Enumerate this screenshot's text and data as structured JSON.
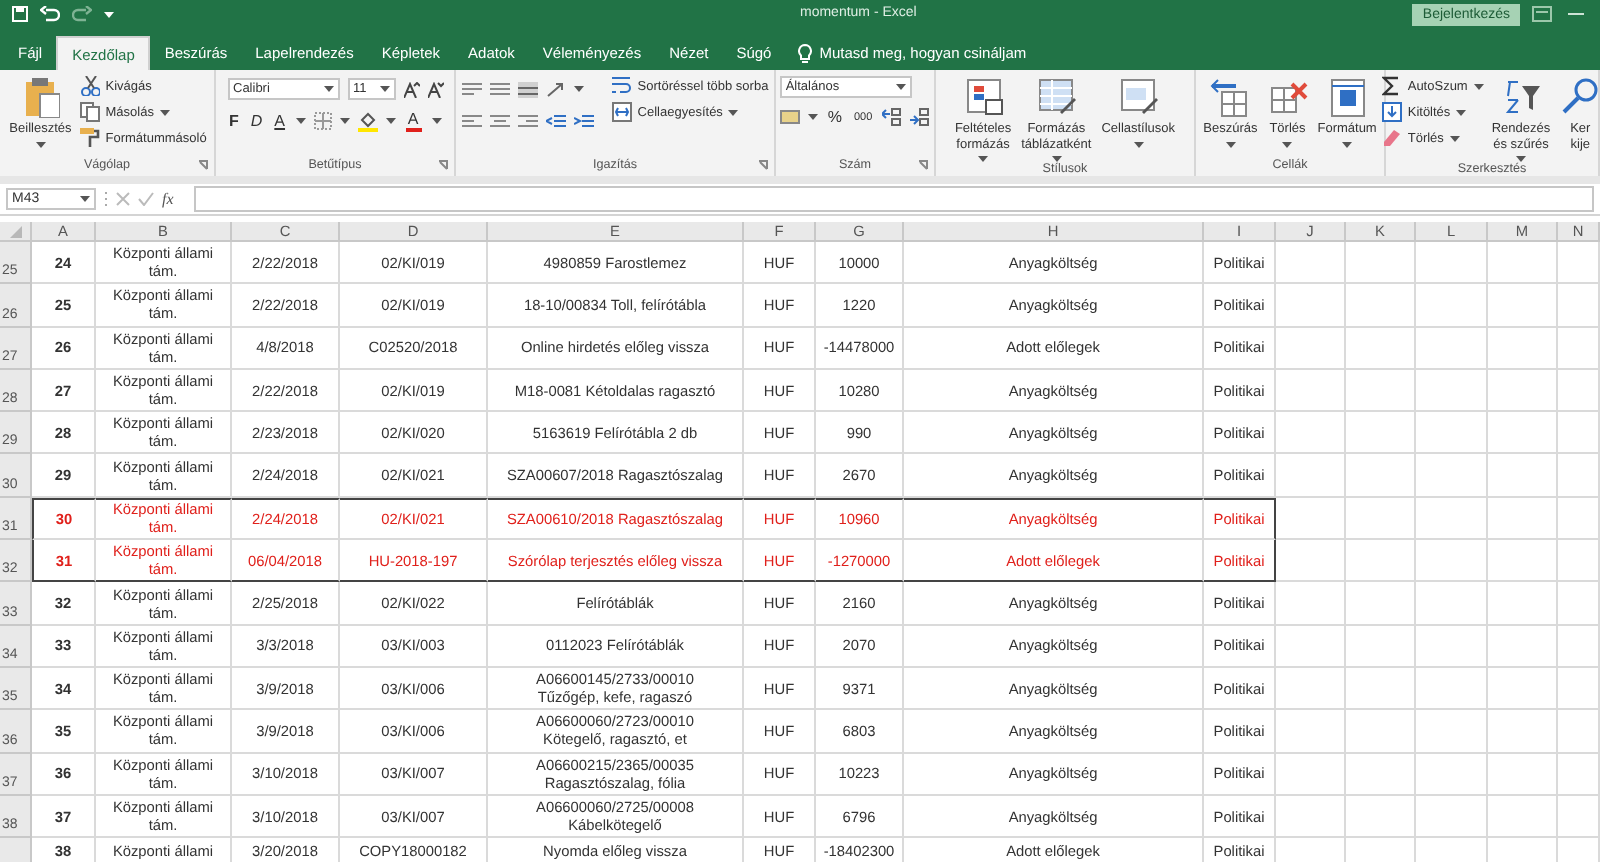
{
  "title_bar": {
    "title": "momentum - Excel",
    "sign_in": "Bejelentkezés"
  },
  "tabs": [
    {
      "label": "Fájl",
      "selected": false
    },
    {
      "label": "Kezdőlap",
      "selected": true
    },
    {
      "label": "Beszúrás",
      "selected": false
    },
    {
      "label": "Lapelrendezés",
      "selected": false
    },
    {
      "label": "Képletek",
      "selected": false
    },
    {
      "label": "Adatok",
      "selected": false
    },
    {
      "label": "Véleményezés",
      "selected": false
    },
    {
      "label": "Nézet",
      "selected": false
    },
    {
      "label": "Súgó",
      "selected": false
    }
  ],
  "tell_me": "Mutasd meg, hogyan csináljam",
  "ribbon": {
    "groups": [
      {
        "label": "Vágólap",
        "launcher": true,
        "items": [
          {
            "kind": "large",
            "label": "Beillesztés",
            "dropdown": true
          },
          {
            "kind": "stack",
            "items": [
              {
                "label": "Kivágás",
                "dropdown": false
              },
              {
                "label": "Másolás",
                "dropdown": true
              },
              {
                "label": "Formátummásoló",
                "dropdown": false
              }
            ]
          }
        ]
      },
      {
        "label": "Betűtípus",
        "launcher": true,
        "items": [
          {
            "kind": "font",
            "font": "Calibri",
            "size": "11",
            "bold": "F",
            "italic": "D",
            "underline": "A",
            "font_color": "A"
          }
        ]
      },
      {
        "label": "Igazítás",
        "launcher": true,
        "items": [
          {
            "kind": "align"
          },
          {
            "kind": "stack",
            "items": [
              {
                "label": "Sortöréssel több sorba",
                "dropdown": false
              },
              {
                "label": "Cellaegyesítés",
                "dropdown": true
              }
            ]
          }
        ]
      },
      {
        "label": "Szám",
        "launcher": true,
        "items": [
          {
            "kind": "number",
            "format": "Általános",
            "percent": "%",
            "thousands": "000"
          }
        ]
      },
      {
        "label": "Stílusok",
        "launcher": false,
        "items": [
          {
            "kind": "large",
            "label": "Feltételes\nformázás",
            "dropdown": true
          },
          {
            "kind": "large",
            "label": "Formázás\ntáblázatként",
            "dropdown": true
          },
          {
            "kind": "large",
            "label": "Cellastílusok",
            "dropdown": true
          }
        ]
      },
      {
        "label": "Cellák",
        "launcher": false,
        "items": [
          {
            "kind": "large",
            "label": "Beszúrás",
            "dropdown": true
          },
          {
            "kind": "large",
            "label": "Törlés",
            "dropdown": true
          },
          {
            "kind": "large",
            "label": "Formátum",
            "dropdown": true
          }
        ]
      },
      {
        "label": "Szerkesztés",
        "launcher": false,
        "items": [
          {
            "kind": "stack",
            "items": [
              {
                "label": "AutoSzum",
                "dropdown": true
              },
              {
                "label": "Kitöltés",
                "dropdown": true
              },
              {
                "label": "Törlés",
                "dropdown": true
              }
            ]
          },
          {
            "kind": "large",
            "label": "Rendezés\nés szűrés",
            "dropdown": true
          },
          {
            "kind": "large",
            "label": "Ker\nkije",
            "dropdown": false
          }
        ]
      }
    ]
  },
  "formula_bar": {
    "name_box": "M43",
    "fx": "fx"
  },
  "sheet": {
    "columns": [
      "A",
      "B",
      "C",
      "D",
      "E",
      "F",
      "G",
      "H",
      "I",
      "J",
      "K",
      "L",
      "M",
      "N"
    ],
    "rows": [
      {
        "header": "25",
        "highlighted": false,
        "cells": [
          "24",
          "Központi állami\ntám.",
          "2/22/2018",
          "02/KI/019",
          "4980859 Farostlemez",
          "HUF",
          "10000",
          "Anyagköltség",
          "Politikai"
        ]
      },
      {
        "header": "26",
        "highlighted": false,
        "cells": [
          "25",
          "Központi állami\ntám.",
          "2/22/2018",
          "02/KI/019",
          "18-10/00834 Toll, felírótábla",
          "HUF",
          "1220",
          "Anyagköltség",
          "Politikai"
        ]
      },
      {
        "header": "27",
        "highlighted": false,
        "cells": [
          "26",
          "Központi állami\ntám.",
          "4/8/2018",
          "C02520/2018",
          "Online hirdetés előleg vissza",
          "HUF",
          "-14478000",
          "Adott előlegek",
          "Politikai"
        ]
      },
      {
        "header": "28",
        "highlighted": false,
        "cells": [
          "27",
          "Központi állami\ntám.",
          "2/22/2018",
          "02/KI/019",
          "M18-0081 Kétoldalas ragasztó",
          "HUF",
          "10280",
          "Anyagköltség",
          "Politikai"
        ]
      },
      {
        "header": "29",
        "highlighted": false,
        "cells": [
          "28",
          "Központi állami\ntám.",
          "2/23/2018",
          "02/KI/020",
          "5163619 Felírótábla 2 db",
          "HUF",
          "990",
          "Anyagköltség",
          "Politikai"
        ]
      },
      {
        "header": "30",
        "highlighted": false,
        "cells": [
          "29",
          "Központi állami\ntám.",
          "2/24/2018",
          "02/KI/021",
          "SZA00607/2018 Ragasztószalag",
          "HUF",
          "2670",
          "Anyagköltség",
          "Politikai"
        ]
      },
      {
        "header": "31",
        "highlighted": true,
        "cells": [
          "30",
          "Központi állami\ntám.",
          "2/24/2018",
          "02/KI/021",
          "SZA00610/2018 Ragasztószalag",
          "HUF",
          "10960",
          "Anyagköltség",
          "Politikai"
        ]
      },
      {
        "header": "32",
        "highlighted": true,
        "cells": [
          "31",
          "Központi állami\ntám.",
          "06/04/2018",
          "HU-2018-197",
          "Szórólap terjesztés előleg vissza",
          "HUF",
          "-1270000",
          "Adott előlegek",
          "Politikai"
        ]
      },
      {
        "header": "33",
        "highlighted": false,
        "cells": [
          "32",
          "Központi állami\ntám.",
          "2/25/2018",
          "02/KI/022",
          "Felírótáblák",
          "HUF",
          "2160",
          "Anyagköltség",
          "Politikai"
        ]
      },
      {
        "header": "34",
        "highlighted": false,
        "cells": [
          "33",
          "Központi állami\ntám.",
          "3/3/2018",
          "03/KI/003",
          "0112023 Felírótáblák",
          "HUF",
          "2070",
          "Anyagköltség",
          "Politikai"
        ]
      },
      {
        "header": "35",
        "highlighted": false,
        "cells": [
          "34",
          "Központi állami\ntám.",
          "3/9/2018",
          "03/KI/006",
          "A06600145/2733/00010\nTűzőgép, kefe, ragaszó",
          "HUF",
          "9371",
          "Anyagköltség",
          "Politikai"
        ]
      },
      {
        "header": "36",
        "highlighted": false,
        "cells": [
          "35",
          "Központi állami\ntám.",
          "3/9/2018",
          "03/KI/006",
          "A06600060/2723/00010\nKötegelő, ragasztó, et",
          "HUF",
          "6803",
          "Anyagköltség",
          "Politikai"
        ]
      },
      {
        "header": "37",
        "highlighted": false,
        "cells": [
          "36",
          "Központi állami\ntám.",
          "3/10/2018",
          "03/KI/007",
          "A06600215/2365/00035\nRagasztószalag, fólia",
          "HUF",
          "10223",
          "Anyagköltség",
          "Politikai"
        ]
      },
      {
        "header": "38",
        "highlighted": false,
        "cells": [
          "37",
          "Központi állami\ntám.",
          "3/10/2018",
          "03/KI/007",
          "A06600060/2725/00008\nKábelkötegelő",
          "HUF",
          "6796",
          "Anyagköltség",
          "Politikai"
        ]
      },
      {
        "highlighted": false,
        "cells": [
          "38",
          "Központi állami",
          "3/20/2018",
          "COPY18000182",
          "Nyomda előleg vissza",
          "HUF",
          "-18402300",
          "Adott előlegek",
          "Politikai"
        ]
      }
    ]
  }
}
